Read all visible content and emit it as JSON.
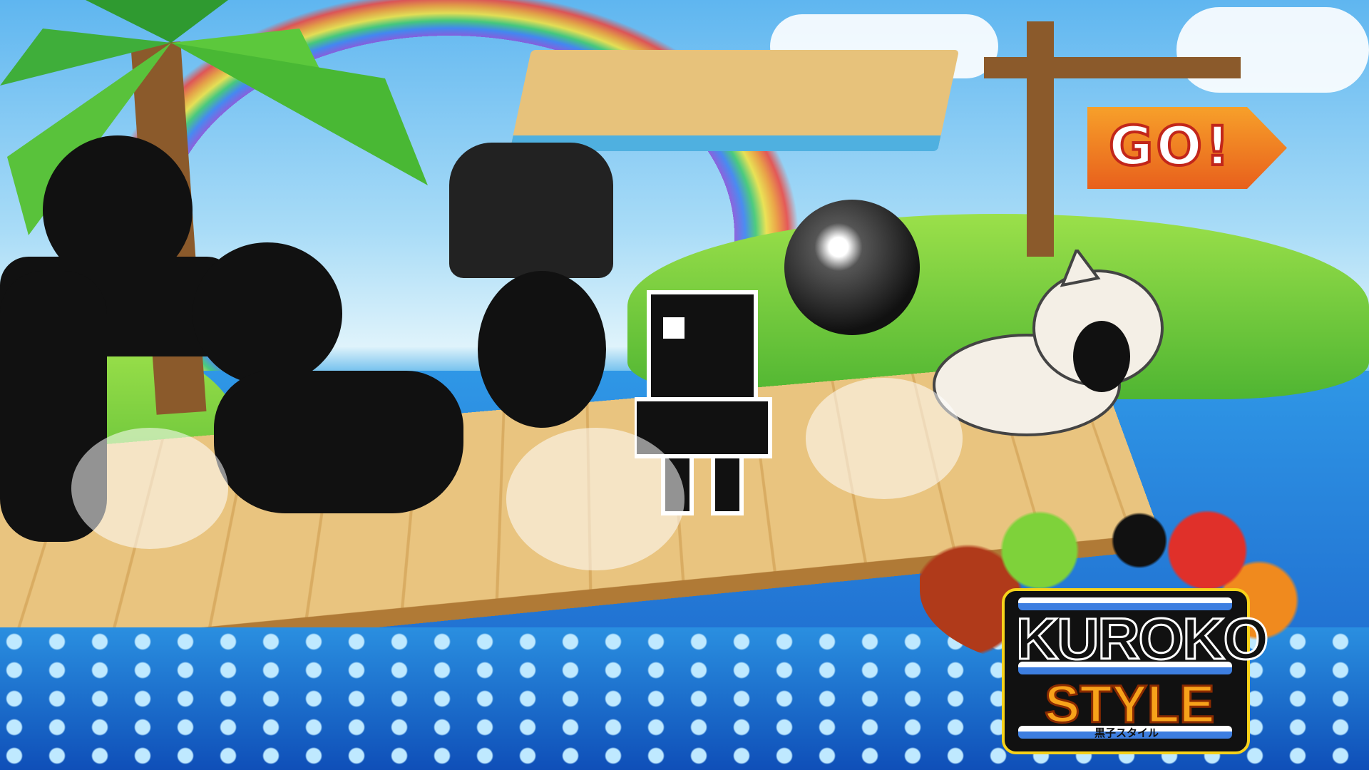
{
  "scene": {
    "sign": {
      "text": "GO!"
    },
    "logo": {
      "title_line1": "KUROKO",
      "title_line2": "STYLE",
      "subtitle_jp": "黒子スタイル"
    }
  },
  "colors": {
    "sky": "#5fb6f0",
    "sea": "#1f7fd6",
    "sign": "#f07a22",
    "logo_title": "#111111",
    "logo_style": "#f7a21a"
  }
}
